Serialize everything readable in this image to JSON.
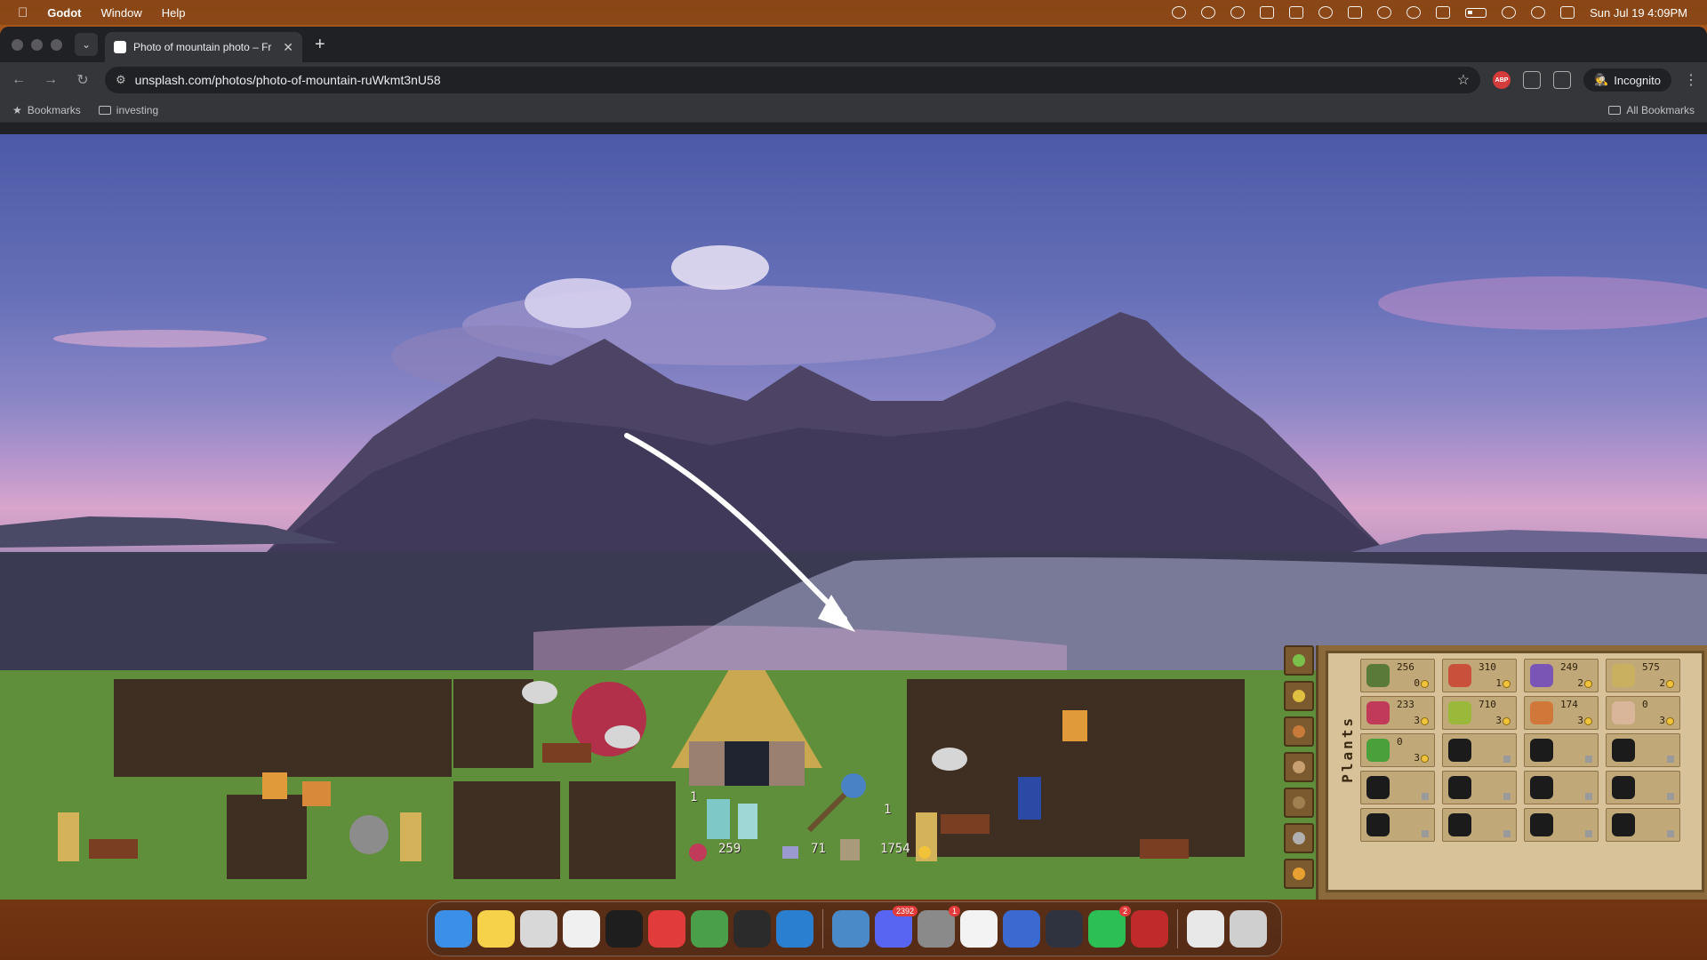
{
  "menubar": {
    "app_name": "Godot",
    "menus": [
      "Window",
      "Help"
    ],
    "clock": "Sun Jul 19  4:09PM"
  },
  "browser": {
    "tab_title": "Photo of mountain photo – Fr",
    "url": "unsplash.com/photos/photo-of-mountain-ruWkmt3nU58",
    "profile_label": "Incognito",
    "bookmarks": [
      "Bookmarks",
      "investing"
    ],
    "all_bookmarks": "All Bookmarks",
    "extensions": [
      "abp-extension-icon",
      "puzzle-extension-icon",
      "sync-icon"
    ],
    "abp_label": "ABP"
  },
  "game": {
    "inventory_tab": "Plants",
    "hud": {
      "potion_count": "259",
      "gem_count": "71",
      "coin_total": "1754",
      "bottle_count": "1",
      "mill_count": "1"
    },
    "inventory_slots": [
      {
        "qty": "256",
        "price": "0",
        "color": "#5a7a3a",
        "locked": false
      },
      {
        "qty": "310",
        "price": "1",
        "color": "#c9503a",
        "locked": false
      },
      {
        "qty": "249",
        "price": "2",
        "color": "#7a55b5",
        "locked": false
      },
      {
        "qty": "575",
        "price": "2",
        "color": "#c8b060",
        "locked": false
      },
      {
        "qty": "233",
        "price": "3",
        "color": "#c23a5a",
        "locked": false
      },
      {
        "qty": "710",
        "price": "3",
        "color": "#9ab83a",
        "locked": false
      },
      {
        "qty": "174",
        "price": "3",
        "color": "#d0773a",
        "locked": false
      },
      {
        "qty": "0",
        "price": "3",
        "color": "#d9b59a",
        "locked": false
      },
      {
        "qty": "0",
        "price": "3",
        "color": "#4aa03a",
        "locked": false
      },
      {
        "qty": "",
        "price": "",
        "color": "#1b1b1b",
        "locked": true
      },
      {
        "qty": "",
        "price": "",
        "color": "#1b1b1b",
        "locked": true
      },
      {
        "qty": "",
        "price": "",
        "color": "#1b1b1b",
        "locked": true
      },
      {
        "qty": "",
        "price": "",
        "color": "#1b1b1b",
        "locked": true
      },
      {
        "qty": "",
        "price": "",
        "color": "#1b1b1b",
        "locked": true
      },
      {
        "qty": "",
        "price": "",
        "color": "#1b1b1b",
        "locked": true
      },
      {
        "qty": "",
        "price": "",
        "color": "#1b1b1b",
        "locked": true
      },
      {
        "qty": "",
        "price": "",
        "color": "#1b1b1b",
        "locked": true
      },
      {
        "qty": "",
        "price": "",
        "color": "#1b1b1b",
        "locked": true
      },
      {
        "qty": "",
        "price": "",
        "color": "#1b1b1b",
        "locked": true
      },
      {
        "qty": "",
        "price": "",
        "color": "#1b1b1b",
        "locked": true
      }
    ]
  },
  "dock": {
    "apps": [
      {
        "name": "finder",
        "color": "#3b8fe6"
      },
      {
        "name": "notes",
        "color": "#f5d24a"
      },
      {
        "name": "launchpad",
        "color": "#d8d8d8"
      },
      {
        "name": "safari-like",
        "color": "#f0f0f0"
      },
      {
        "name": "terminal",
        "color": "#1e1e1e"
      },
      {
        "name": "vivaldi",
        "color": "#e23b3b"
      },
      {
        "name": "chrome",
        "color": "#4aa04a"
      },
      {
        "name": "obs",
        "color": "#2b2b2b"
      },
      {
        "name": "vscode",
        "color": "#2a7fd0"
      },
      {
        "name": "godot",
        "color": "#4a8ac9"
      },
      {
        "name": "discord",
        "color": "#5865f2",
        "badge": "2392"
      },
      {
        "name": "system-settings",
        "color": "#8a8a8a",
        "badge": "1"
      },
      {
        "name": "notes-2",
        "color": "#f3f3f3"
      },
      {
        "name": "tableplus",
        "color": "#3a6ad0"
      },
      {
        "name": "app-dark",
        "color": "#2f3340"
      },
      {
        "name": "whatsapp",
        "color": "#2bbf55",
        "badge": "2"
      },
      {
        "name": "app-red",
        "color": "#c02a2a"
      },
      {
        "name": "downloads",
        "color": "#e8e8e8"
      },
      {
        "name": "trash",
        "color": "#cfcfcf"
      }
    ]
  }
}
